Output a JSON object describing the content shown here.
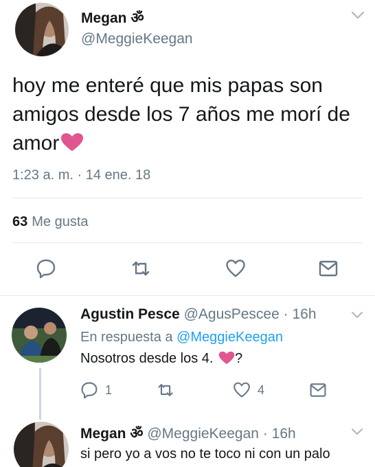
{
  "main_tweet": {
    "name": "Megan",
    "name_symbol": "ॐ",
    "handle": "@MeggieKeegan",
    "text": "hoy me enteré que mis papas son amigos desde los 7 años me morí de amor",
    "timestamp": "1:23 a. m. · 14 ene. 18",
    "likes_count": "63",
    "likes_label": "Me gusta",
    "icons": [
      "reply-icon",
      "retweet-icon",
      "like-icon",
      "message-icon",
      "chevron-down-icon"
    ]
  },
  "reply": {
    "name": "Agustin Pesce",
    "handle": "@AgusPescee",
    "separator": " · ",
    "time": "16h",
    "in_reply_prefix": "En respuesta a ",
    "in_reply_handle": "@MeggieKeegan",
    "text_before_heart": "Nosotros desde los 4. ",
    "text_after_heart": "?",
    "reply_count": "1",
    "like_count": "4"
  },
  "last_reply": {
    "name": "Megan",
    "name_symbol": "ॐ",
    "handle": "@MeggieKeegan",
    "separator": " · ",
    "time": "16h",
    "text": "si pero yo a vos no te toco ni con un palo"
  },
  "colors": {
    "text": "#14171a",
    "muted": "#657786",
    "link": "#1da1f2",
    "heart": "#e0568f",
    "divider": "#e1e8ed"
  }
}
